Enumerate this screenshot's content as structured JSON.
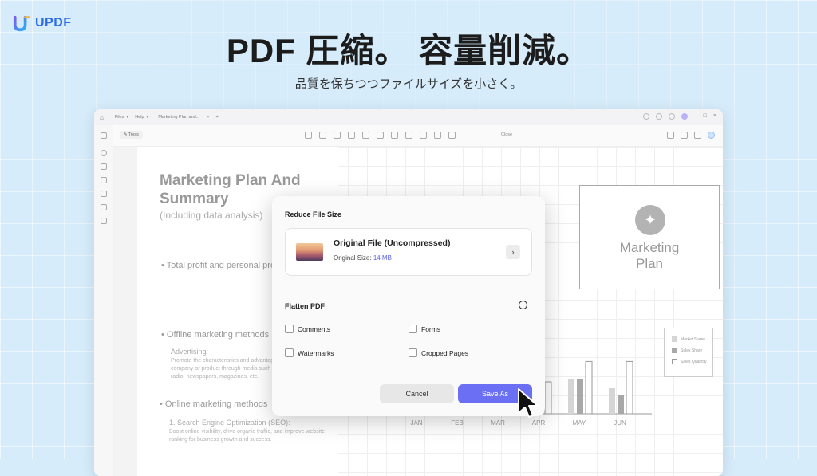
{
  "brand": {
    "logo_text": "UPDF",
    "color": "#2b6de8"
  },
  "hero": {
    "headline": "PDF 圧縮。 容量削減。",
    "subline": "品質を保ちつつファイルサイズを小さく。"
  },
  "app": {
    "titlebar": {
      "files": "Files",
      "help": "Help",
      "tab": "Marketing Plan and...",
      "tab_close": "×",
      "tab_add": "+"
    },
    "toolbar": {
      "tools": "Tools",
      "close": "Close"
    },
    "document": {
      "title": "Marketing Plan And Summary",
      "subtitle": "(Including data analysis)",
      "bullet1": "Total profit and personal profit",
      "bullet2": "Offline marketing methods",
      "advertising_heading": "Advertising:",
      "advertising_text": "Promote the characteristics and advantages of the company or product through media such as TV, radio, newspapers, magazines, etc.",
      "bullet3": "Online marketing methods",
      "seo_heading": "1. Search Engine Optimization (SEO):",
      "seo_text": "Boost online visibility, drive organic traffic, and improve website ranking for business growth and success.",
      "marketing_box": "Marketing Plan"
    },
    "legend": [
      "Market Share",
      "Sales Share",
      "Sales Quantity"
    ]
  },
  "dialog": {
    "title": "Reduce File Size",
    "file_name": "Original File (Uncompressed)",
    "size_label": "Original Size:",
    "size_value": "14 MB",
    "flatten_title": "Flatten PDF",
    "options": {
      "comments": "Comments",
      "forms": "Forms",
      "watermarks": "Watermarks",
      "cropped_pages": "Cropped Pages"
    },
    "cancel": "Cancel",
    "save_as": "Save As",
    "accent": "#6b6ff3"
  },
  "chart_data": {
    "type": "bar",
    "categories": [
      "JAN",
      "FEB",
      "MAR",
      "APR",
      "MAY",
      "JUN"
    ],
    "series": [
      {
        "name": "Market Share",
        "values": [
          null,
          null,
          null,
          55,
          55,
          40
        ]
      },
      {
        "name": "Sales Share",
        "values": [
          null,
          null,
          null,
          40,
          55,
          30
        ]
      },
      {
        "name": "Sales Quantity",
        "values": [
          null,
          null,
          null,
          50,
          82,
          82
        ]
      }
    ],
    "ylim": [
      0,
      100
    ]
  }
}
